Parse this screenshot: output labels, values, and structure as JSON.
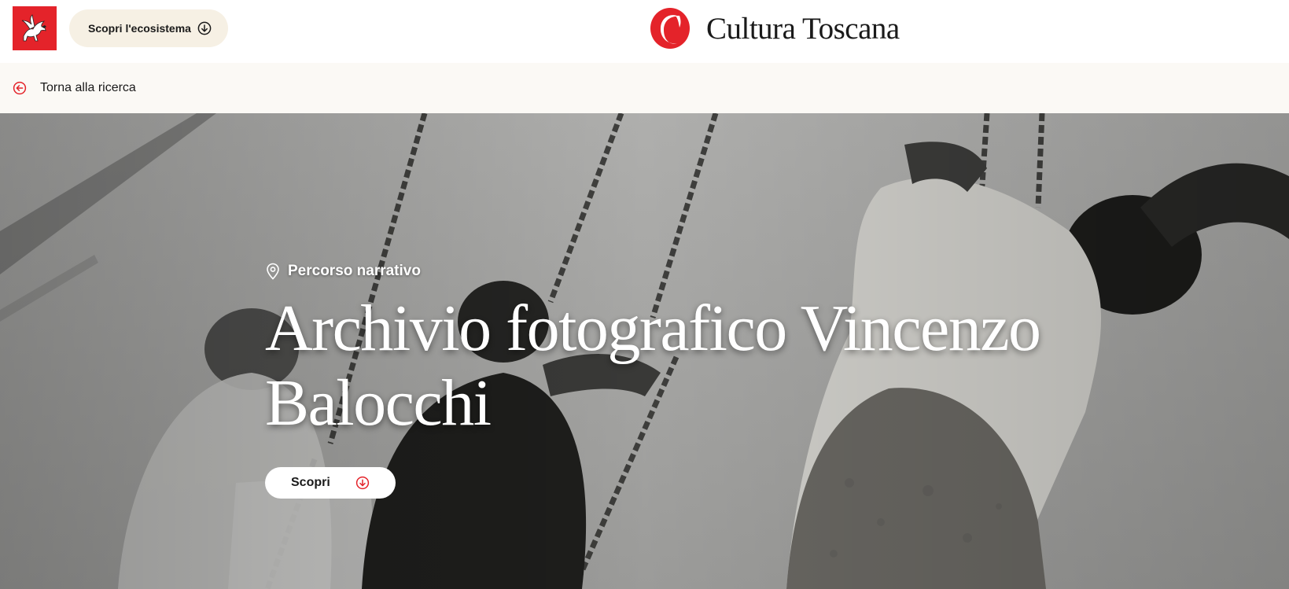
{
  "header": {
    "ecosystem_button": {
      "label": "Scopri l'ecosistema",
      "icon": "arrow-down-circle-icon"
    },
    "brand": {
      "name": "Cultura Toscana",
      "accent": "#e4232a"
    },
    "region_logo": {
      "icon": "pegasus-icon",
      "color": "#e4232a"
    }
  },
  "back_bar": {
    "label": "Torna alla ricerca",
    "icon": "arrow-left-circle-icon"
  },
  "hero": {
    "kicker": "Percorso narrativo",
    "kicker_icon": "location-pin-icon",
    "title": "Archivio fotografico Vincenzo Balocchi",
    "cta": {
      "label": "Scopri",
      "icon": "arrow-down-circle-icon"
    }
  },
  "colors": {
    "accent": "#e4232a",
    "button_beige": "#f6f0e4",
    "back_bar_bg": "#fbf9f5"
  }
}
